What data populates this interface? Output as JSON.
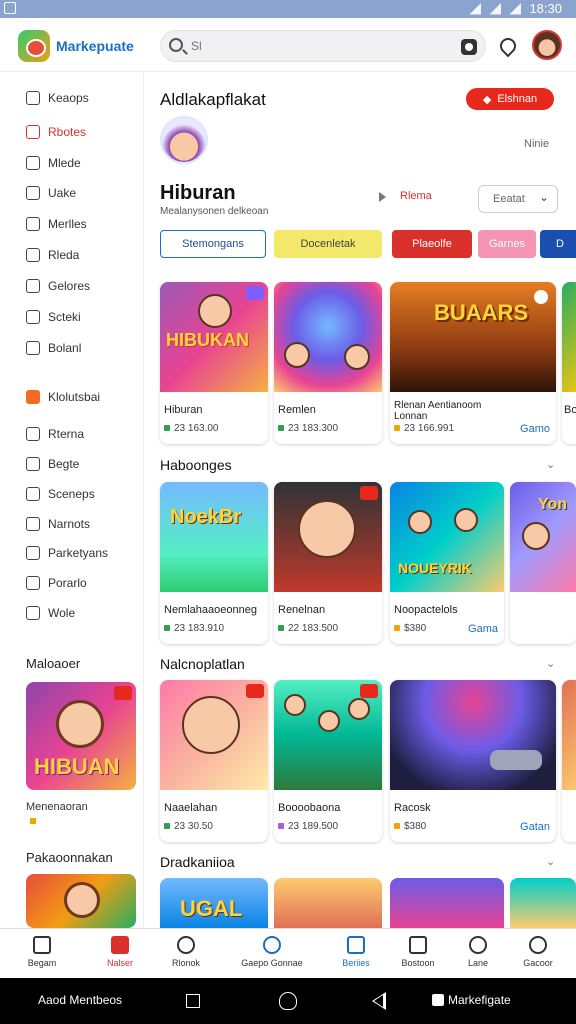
{
  "status_bar": {
    "time": "18:30"
  },
  "app": {
    "brand": "Markepuate",
    "search_placeholder": "Sl"
  },
  "sidebar": {
    "items": [
      {
        "label": "Keaops",
        "active": false
      },
      {
        "label": "Rbotes",
        "active": true
      },
      {
        "label": "Mlede",
        "active": false
      },
      {
        "label": "Uake",
        "active": false
      },
      {
        "label": "Merlles",
        "active": false
      },
      {
        "label": "Rleda",
        "active": false
      },
      {
        "label": "Gelores",
        "active": false
      },
      {
        "label": "Scteki",
        "active": false
      },
      {
        "label": "Bolanl",
        "active": false
      }
    ],
    "section_label": "Klolutsbai",
    "items2": [
      {
        "label": "Rterna"
      },
      {
        "label": "Begte"
      },
      {
        "label": "Sceneps"
      },
      {
        "label": "Narnots"
      },
      {
        "label": "Parketyans"
      },
      {
        "label": "Porarlo"
      },
      {
        "label": "Wole"
      }
    ],
    "heading1": "Maloaoer",
    "card1_art_text": "HIBUAN",
    "card1_caption": "Menenaoran",
    "heading2": "Pakaoonnakan"
  },
  "main": {
    "greeting": "Aldlakapflakat",
    "promo_button": "Elshnan",
    "more_link": "Ninie",
    "section_title": "Hiburan",
    "section_sub": "Mealanysonen delkeoan",
    "filter_link": "Rlema",
    "select_value": "Eeatat",
    "chips": [
      {
        "label": "Stemongans",
        "bg": "#ffffff",
        "border": "#1a6fc4",
        "color": "#1a4f8f"
      },
      {
        "label": "Docenletak",
        "bg": "#f2e86a",
        "border": "#f2e86a",
        "color": "#444"
      },
      {
        "label": "Plaeolfe",
        "bg": "#d9302c",
        "border": "#d9302c",
        "color": "#ffffff"
      },
      {
        "label": "Garnes",
        "bg": "#f594b4",
        "border": "#f594b4",
        "color": "#ffffff"
      },
      {
        "label": "D",
        "bg": "#1a4fb0",
        "border": "#1a4fb0",
        "color": "#ffffff"
      }
    ],
    "row1": [
      {
        "title": "Hiburan",
        "rating": "23 163.00",
        "art_text": "HIBUKAN",
        "tag": ""
      },
      {
        "title": "Remlen",
        "rating": "23 183.300",
        "art_text": "",
        "tag": ""
      },
      {
        "title": "Rlenan Aentianoom Lonnan",
        "rating": "23 166.991",
        "art_text": "BUAARS",
        "tag": "Gamo"
      },
      {
        "title": "Bo",
        "rating": "",
        "art_text": "",
        "tag": ""
      }
    ],
    "row2_title": "Haboonges",
    "row2": [
      {
        "title": "Nemlahaaoeonneg",
        "rating": "23 183.910",
        "art_text": "NoekBr",
        "tag": ""
      },
      {
        "title": "Renelnan",
        "rating": "22 183.500",
        "art_text": "",
        "tag": ""
      },
      {
        "title": "Noopactelols",
        "rating": "$380",
        "art_text": "NOUEYRIK",
        "tag": "Gama"
      },
      {
        "title": "",
        "rating": "",
        "art_text": "Yon",
        "tag": ""
      }
    ],
    "row3_title": "Nalcnoplatlan",
    "row3": [
      {
        "title": "Naaelahan",
        "rating": "23 30.50",
        "art_text": "",
        "tag": ""
      },
      {
        "title": "Boooobaona",
        "rating": "23 189.500",
        "art_text": "",
        "tag": ""
      },
      {
        "title": "Racosk",
        "rating": "$380",
        "art_text": "",
        "tag": "Gatan"
      }
    ],
    "row4_title": "Dradkaniioa",
    "row4_art": "UGAL"
  },
  "bottom_nav": [
    {
      "label": "Begam",
      "state": "normal"
    },
    {
      "label": "Nalser",
      "state": "red"
    },
    {
      "label": "Rlonok",
      "state": "normal"
    },
    {
      "label": "Gaepo Gonnae",
      "state": "normal"
    },
    {
      "label": "Beriies",
      "state": "blue"
    },
    {
      "label": "Bostoon",
      "state": "normal"
    },
    {
      "label": "Lane",
      "state": "normal"
    },
    {
      "label": "Gacoor",
      "state": "normal"
    }
  ],
  "system_nav": {
    "left": "Aaod Mentbeos",
    "right": "Markefigate"
  }
}
